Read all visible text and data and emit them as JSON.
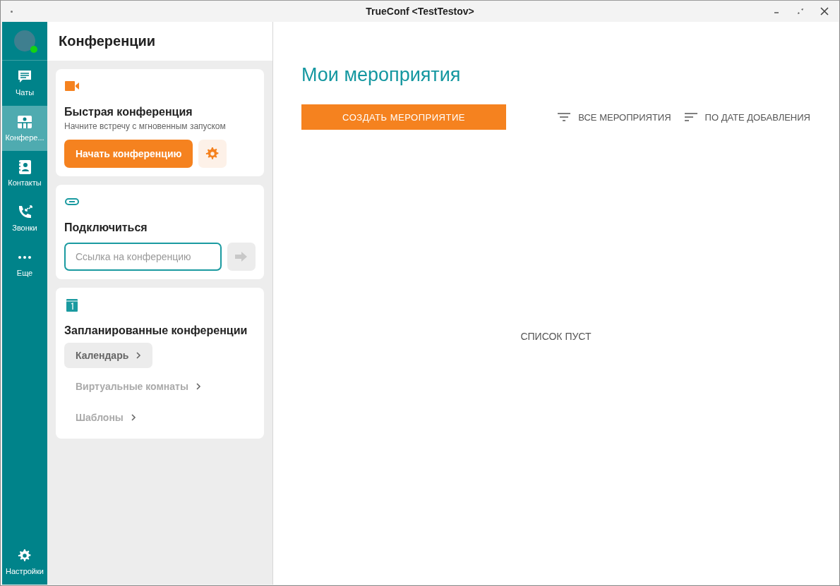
{
  "window": {
    "title": "TrueConf <TestTestov>"
  },
  "nav": {
    "items": [
      {
        "label": "Чаты",
        "kind": "chat",
        "selected": false
      },
      {
        "label": "Конфере...",
        "kind": "conf",
        "selected": true
      },
      {
        "label": "Контакты",
        "kind": "contacts",
        "selected": false
      },
      {
        "label": "Звонки",
        "kind": "calls",
        "selected": false
      },
      {
        "label": "Еще",
        "kind": "more",
        "selected": false
      }
    ],
    "settings": {
      "label": "Настройки"
    },
    "avatar": {
      "online": true
    }
  },
  "panel": {
    "title": "Конференции",
    "quick": {
      "title": "Быстрая конференция",
      "subtitle": "Начните встречу с мгновенным запуском",
      "button": "Начать конференцию"
    },
    "connect": {
      "title": "Подключиться",
      "placeholder": "Ссылка на конференцию"
    },
    "scheduled": {
      "title": "Запланированные конференции",
      "links": [
        {
          "label": "Календарь",
          "selected": true
        },
        {
          "label": "Виртуальные комнаты",
          "selected": false
        },
        {
          "label": "Шаблоны",
          "selected": false
        }
      ]
    }
  },
  "main": {
    "title": "Мои мероприятия",
    "create_button": "СОЗДАТЬ МЕРОПРИЯТИЕ",
    "filter": "ВСЕ МЕРОПРИЯТИЯ",
    "sort": "ПО ДАТЕ ДОБАВЛЕНИЯ",
    "empty": "СПИСОК ПУСТ"
  }
}
